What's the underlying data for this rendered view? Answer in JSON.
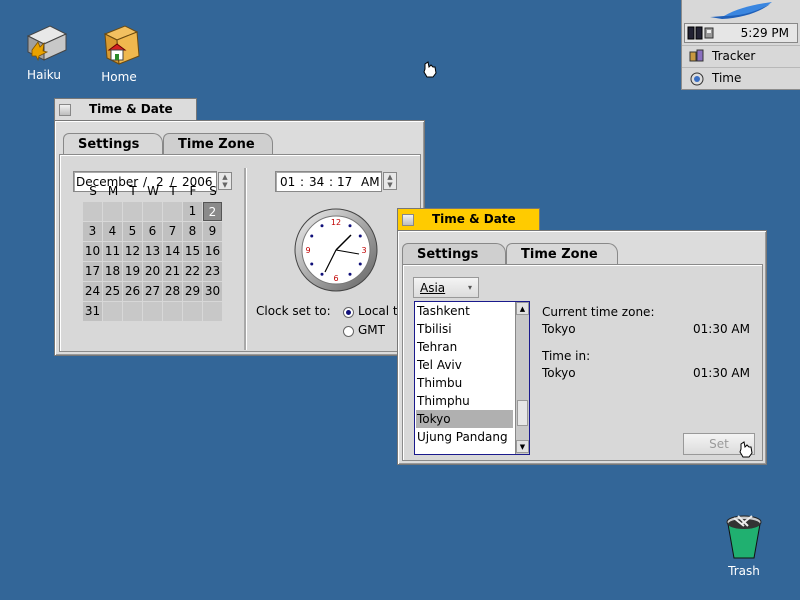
{
  "desktop": {
    "icons": [
      {
        "label": "Haiku"
      },
      {
        "label": "Home"
      },
      {
        "label": "Trash"
      }
    ]
  },
  "deskbar": {
    "clock": "5:29 PM",
    "items": [
      {
        "label": "Tracker"
      },
      {
        "label": "Time"
      }
    ]
  },
  "window1": {
    "title": "Time & Date",
    "tabs": [
      {
        "label": "Settings"
      },
      {
        "label": "Time Zone"
      }
    ],
    "date": {
      "month": "December",
      "day": "2",
      "year": "2006"
    },
    "time": {
      "hour": "01",
      "minute": "34",
      "second": "17",
      "ampm": "AM"
    },
    "calendar": {
      "weekdays": [
        "S",
        "M",
        "T",
        "W",
        "T",
        "F",
        "S"
      ],
      "selected_day": 2,
      "first_weekday": 5,
      "days_in_month": 31
    },
    "clock_set": {
      "label": "Clock set to:",
      "options": [
        {
          "label": "Local t",
          "selected": true
        },
        {
          "label": "GMT",
          "selected": false
        }
      ]
    }
  },
  "window2": {
    "title": "Time & Date",
    "tabs": [
      {
        "label": "Settings"
      },
      {
        "label": "Time Zone"
      }
    ],
    "region": "Asia",
    "cities": [
      "Tashkent",
      "Tbilisi",
      "Tehran",
      "Tel Aviv",
      "Thimbu",
      "Thimphu",
      "Tokyo",
      "Ujung Pandang"
    ],
    "selected_city": "Tokyo",
    "current_zone_label": "Current time zone:",
    "current_zone_city": "Tokyo",
    "current_zone_time": "01:30 AM",
    "time_in_label": "Time in:",
    "time_in_city": "Tokyo",
    "time_in_time": "01:30 AM",
    "set_button": "Set"
  },
  "colors": {
    "desktop": "#336698",
    "active_tab": "#ffcb00",
    "inactive_tab": "#dcdcdc"
  }
}
